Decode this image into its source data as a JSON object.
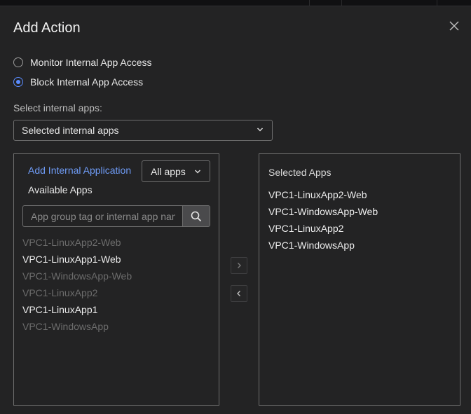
{
  "dialog": {
    "title": "Add Action"
  },
  "mode_options": [
    {
      "label": "Monitor Internal App Access",
      "checked": false
    },
    {
      "label": "Block Internal App Access",
      "checked": true
    }
  ],
  "select": {
    "label": "Select internal apps:",
    "value": "Selected internal apps"
  },
  "available_panel": {
    "add_link": "Add Internal Application",
    "filter_value": "All apps",
    "heading": "Available Apps",
    "search_placeholder": "App group tag or internal app name",
    "items": [
      {
        "label": "VPC1-LinuxApp2-Web",
        "enabled": false
      },
      {
        "label": "VPC1-LinuxApp1-Web",
        "enabled": true
      },
      {
        "label": "VPC1-WindowsApp-Web",
        "enabled": false
      },
      {
        "label": "VPC1-LinuxApp2",
        "enabled": false
      },
      {
        "label": "VPC1-LinuxApp1",
        "enabled": true
      },
      {
        "label": "VPC1-WindowsApp",
        "enabled": false
      }
    ]
  },
  "selected_panel": {
    "heading": "Selected Apps",
    "items": [
      "VPC1-LinuxApp2-Web",
      "VPC1-WindowsApp-Web",
      "VPC1-LinuxApp2",
      "VPC1-WindowsApp"
    ]
  },
  "icons": {
    "close": "close-icon",
    "dropdown": "chevron-down-icon",
    "search": "search-icon",
    "move_right": "chevron-right-icon",
    "move_left": "chevron-left-icon"
  },
  "colors": {
    "accent": "#5b8cff",
    "link": "#6f9cf7",
    "background": "#232324"
  }
}
